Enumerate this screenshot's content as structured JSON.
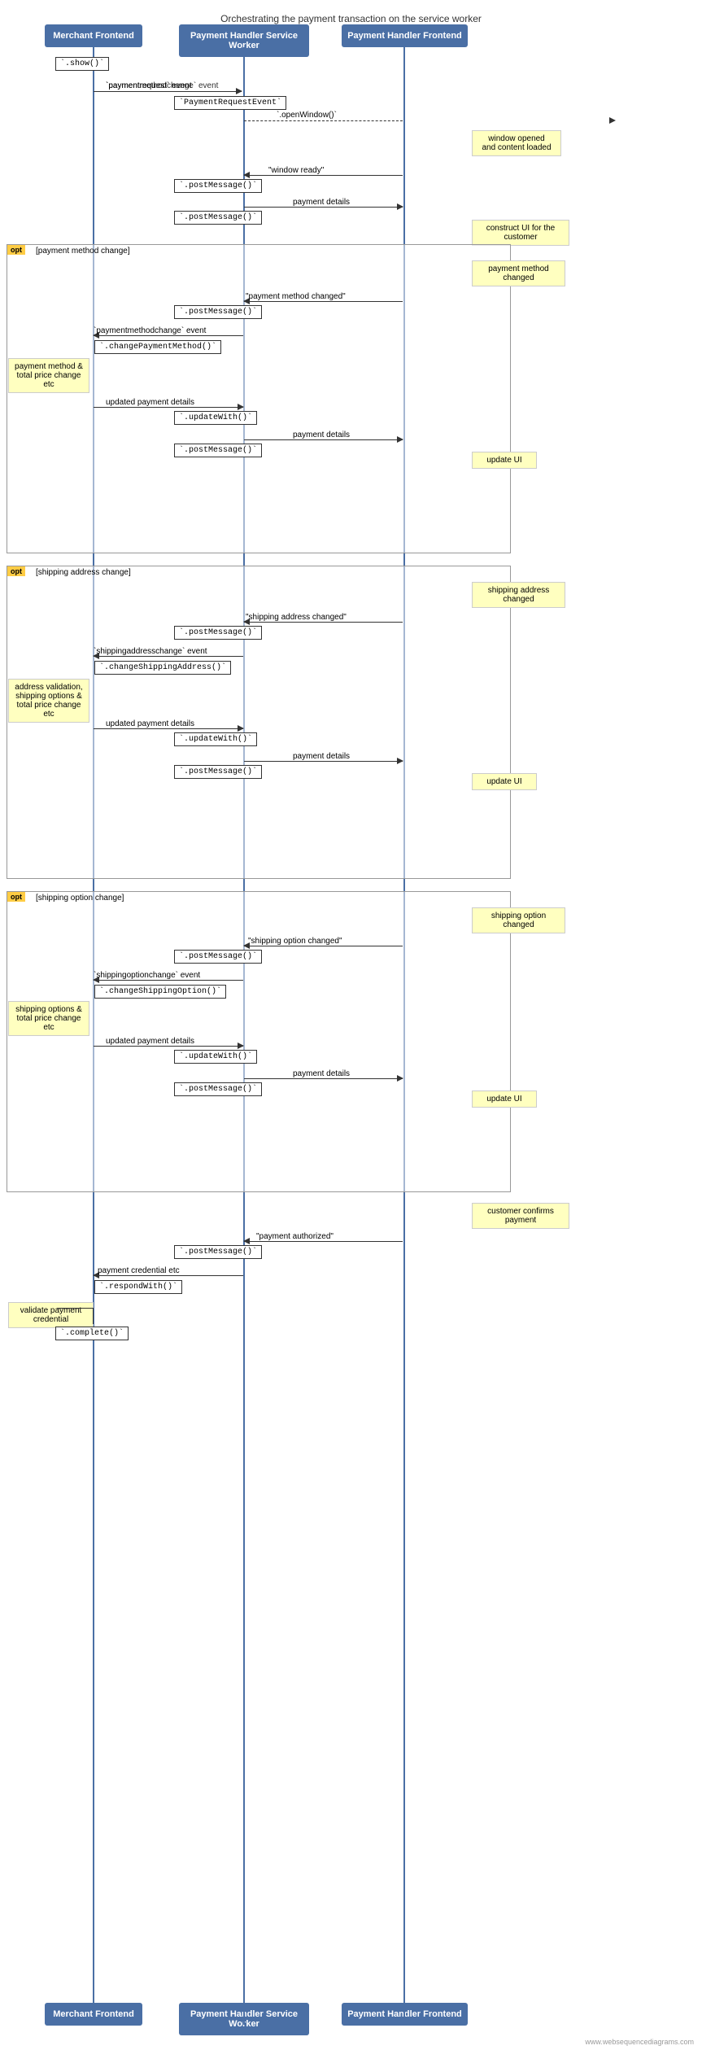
{
  "title": "Orchestrating the payment transaction on the service worker",
  "headers": {
    "merchant": "Merchant Frontend",
    "serviceWorker": "Payment Handler Service Worker",
    "frontend": "Payment Handler Frontend"
  },
  "watermark": "www.websequencediagrams.com",
  "colors": {
    "header_bg": "#4a6fa5",
    "opt_bg": "#ffcc44",
    "note_bg": "#ffffc0"
  },
  "sections": {
    "opt1": {
      "label": "opt",
      "condition": "[payment method change]"
    },
    "opt2": {
      "label": "opt",
      "condition": "[shipping address change]"
    },
    "opt3": {
      "label": "opt",
      "condition": "[shipping option change]"
    }
  },
  "notes": {
    "show": "`.show()`",
    "paymentRequestEvent": "`PaymentRequestEvent`",
    "openWindow": "`.openWindow()`",
    "windowOpened": "window opened\nand content loaded",
    "windowReady": "\"window ready\"",
    "postMessage1": "`.postMessage()`",
    "paymentDetails1": "payment details",
    "postMessage2": "`.postMessage()`",
    "constructUI": "construct UI for the customer",
    "paymentMethodChanged": "payment method changed",
    "paymentMethodChangedMsg": "\"payment method changed\"",
    "postMessage3": "`.postMessage()`",
    "paymentmethodchangeEvent": "`paymentmethodchange` event",
    "changePaymentMethod": "`.changePaymentMethod()`",
    "paymentMethodTotal": "payment method &\ntotal price change etc",
    "updatedPaymentDetails1": "updated payment details",
    "updateWith1": "`.updateWith()`",
    "paymentDetails2": "payment details",
    "postMessage4": "`.postMessage()`",
    "updateUI1": "update UI",
    "shippingAddressChanged": "shipping address changed",
    "shippingAddressChangedMsg": "\"shipping address changed\"",
    "postMessage5": "`.postMessage()`",
    "shippingaddresschangeEvent": "`shippingaddresschange` event",
    "changeShippingAddress": "`.changeShippingAddress()`",
    "addressValidation": "address validation,\nshipping options &\ntotal price change etc",
    "updatedPaymentDetails2": "updated payment details",
    "updateWith2": "`.updateWith()`",
    "paymentDetails3": "payment details",
    "postMessage6": "`.postMessage()`",
    "updateUI2": "update UI",
    "shippingOptionChanged": "shipping option changed",
    "shippingOptionChangedMsg": "\"shipping option changed\"",
    "postMessage7": "`.postMessage()`",
    "shippingoptionchangeEvent": "`shippingoptionchange` event",
    "changeShippingOption": "`.changeShippingOption()`",
    "shippingOptions": "shipping options &\ntotal price change etc",
    "updatedPaymentDetails3": "updated payment details",
    "updateWith3": "`.updateWith()`",
    "paymentDetails4": "payment details",
    "postMessage8": "`.postMessage()`",
    "updateUI3": "update UI",
    "customerConfirms": "customer confirms payment",
    "paymentAuthorized": "\"payment authorized\"",
    "postMessage9": "`.postMessage()`",
    "paymentCredential": "payment credential etc",
    "respondWith": "`.respondWith()`",
    "validatePayment": "validate payment credential",
    "complete": "`.complete()`"
  }
}
